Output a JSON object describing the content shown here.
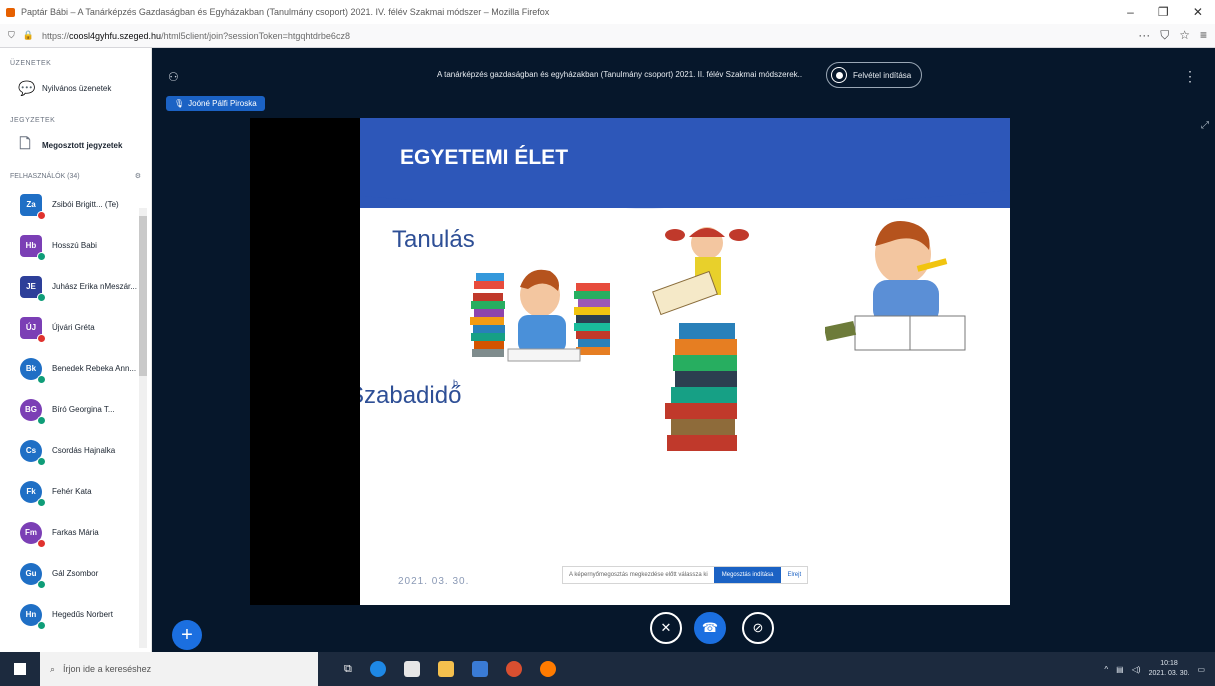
{
  "browser": {
    "window_title": "Paptár Bábi – A Tanárképzés Gazdaságban és Egyházakban (Tanulmány csoport) 2021. IV. félév Szakmai módszer – Mozilla Firefox",
    "url_prefix": "https://",
    "url_domain": "coosl4gyhfu.szeged.hu",
    "url_rest": "/html5client/join?sessionToken=htgqhtdrbe6cz8"
  },
  "sidebar": {
    "messages_title": "ÜZENETEK",
    "public_chat": "Nyilvános üzenetek",
    "notes_title": "JEGYZETEK",
    "shared_notes": "Megosztott jegyzetek",
    "users_title": "FELHASZNÁLÓK (34)",
    "users": [
      {
        "initials": "Za",
        "name": "Zsibói Brigitt... (Te)",
        "color": "#1f6fc5",
        "shape": "square",
        "status": "red"
      },
      {
        "initials": "Hb",
        "name": "Hosszú Babi",
        "color": "#7b3fb5",
        "shape": "square",
        "status": "green"
      },
      {
        "initials": "JE",
        "name": "Juhász Erika nMeszár...",
        "color": "#2d3f99",
        "shape": "square",
        "status": "green"
      },
      {
        "initials": "ÚJ",
        "name": "Újvári Gréta",
        "color": "#7b3fb5",
        "shape": "square",
        "status": "red"
      },
      {
        "initials": "Bk",
        "name": "Benedek Rebeka Ann...",
        "color": "#1f6fc5",
        "shape": "round",
        "status": "green"
      },
      {
        "initials": "BG",
        "name": "Bíró Georgina T...",
        "color": "#7b3fb5",
        "shape": "round",
        "status": "green"
      },
      {
        "initials": "Cs",
        "name": "Csordás Hajnalka",
        "color": "#1f6fc5",
        "shape": "round",
        "status": "green"
      },
      {
        "initials": "Fk",
        "name": "Fehér Kata",
        "color": "#1f6fc5",
        "shape": "round",
        "status": "green"
      },
      {
        "initials": "Fm",
        "name": "Farkas Mária",
        "color": "#7b3fb5",
        "shape": "round",
        "status": "red"
      },
      {
        "initials": "Gu",
        "name": "Gál Zsombor",
        "color": "#1f6fc5",
        "shape": "round",
        "status": "green"
      },
      {
        "initials": "Hn",
        "name": "Hegedűs Norbert",
        "color": "#1f6fc5",
        "shape": "round",
        "status": "green"
      }
    ]
  },
  "meeting": {
    "title": "A tanárképzés gazdaságban és egyházakban (Tanulmány csoport) 2021. II. félév Szakmai módszerek...",
    "record_label": "Felvétel indítása",
    "presenter": "Joóné Pálfi Piroska"
  },
  "slide": {
    "title": "EGYETEMI ÉLET",
    "text_tanulas": "Tanulás",
    "text_szabadido": "Szabadidő",
    "text_b": "b",
    "date": "2021. 03. 30.",
    "share_prompt": "A képernyőmegosztás megkezdése előtt válassza ki",
    "share_button": "Megosztás indítása",
    "hide_label": "Elrejt"
  },
  "taskbar": {
    "search_placeholder": "Írjon ide a kereséshez",
    "time": "10:18",
    "date": "2021. 03. 30."
  },
  "colors": {
    "accent": "#1b6fe0",
    "slide_header": "#2d57b9",
    "background": "#06172b"
  }
}
